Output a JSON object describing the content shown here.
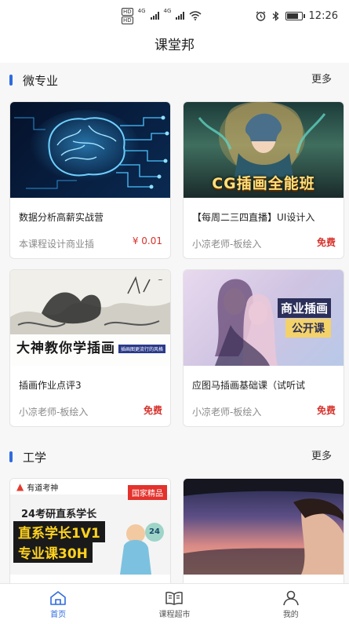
{
  "status": {
    "network1": "4G",
    "network2": "4G",
    "hd1": "HD",
    "hd2": "HD",
    "time": "12:26",
    "battery_level": 0.7
  },
  "app": {
    "title": "课堂邦"
  },
  "sections": [
    {
      "title": "微专业",
      "more": "更多",
      "courses": [
        {
          "name": "数据分析高薪实战营",
          "teacher": "本课程设计商业插",
          "price": "¥ 0.01"
        },
        {
          "name": "【每周二三四直播】UI设计入",
          "teacher": "小凉老师-板绘入",
          "price": "免费",
          "banner": "CG插画全能班"
        },
        {
          "name": "插画作业点评3",
          "teacher": "小凉老师-板绘入",
          "price": "免费",
          "banner": "大神教你学插画",
          "banner_sub": "插画图更流行的风格"
        },
        {
          "name": "应图马插画基础课（试听试",
          "teacher": "小凉老师-板绘入",
          "price": "免费",
          "banner": "商业插画",
          "banner_sub": "公开课"
        }
      ]
    },
    {
      "title": "工学",
      "more": "更多",
      "courses": [
        {
          "brand": "有道考神",
          "tag": "国家精品",
          "line1": "24考研直系学长",
          "line2": "直系学长1V1",
          "line3": "专业课30H",
          "badge": "24"
        },
        {}
      ]
    }
  ],
  "tabs": [
    {
      "label": "首页",
      "icon": "home-icon",
      "active": true
    },
    {
      "label": "课程超市",
      "icon": "book-icon",
      "active": false
    },
    {
      "label": "我的",
      "icon": "user-icon",
      "active": false
    }
  ],
  "colors": {
    "accent": "#2f6bdf",
    "price": "#d7322c"
  }
}
